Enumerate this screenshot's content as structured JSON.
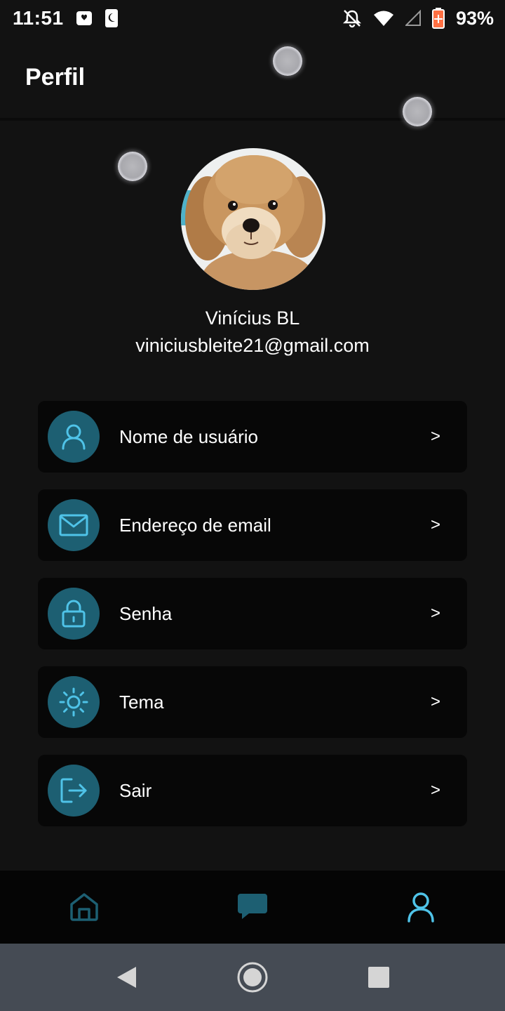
{
  "status_bar": {
    "time": "11:51",
    "battery": "93%",
    "icons": [
      "alarm-icon",
      "moon-icon",
      "notifications-off-icon",
      "wifi-icon",
      "signal-icon",
      "battery-icon"
    ]
  },
  "header": {
    "title": "Perfil"
  },
  "profile": {
    "name": "Vinícius BL",
    "email": "viniciusbleite21@gmail.com",
    "avatar": "dog-photo"
  },
  "menu": {
    "items": [
      {
        "label": "Nome de usuário",
        "icon": "user-icon",
        "chevron": ">"
      },
      {
        "label": "Endereço de email",
        "icon": "mail-icon",
        "chevron": ">"
      },
      {
        "label": "Senha",
        "icon": "lock-icon",
        "chevron": ">"
      },
      {
        "label": "Tema",
        "icon": "sun-icon",
        "chevron": ">"
      },
      {
        "label": "Sair",
        "icon": "logout-icon",
        "chevron": ">"
      }
    ]
  },
  "bottom_nav": {
    "items": [
      {
        "icon": "home-icon",
        "active": false
      },
      {
        "icon": "chat-icon",
        "active": false
      },
      {
        "icon": "profile-icon",
        "active": true
      }
    ]
  },
  "colors": {
    "background": "#121212",
    "card": "#070707",
    "icon_circle": "#1d5f72",
    "accent": "#4fc3e8",
    "nav_inactive": "#1d5f72"
  }
}
